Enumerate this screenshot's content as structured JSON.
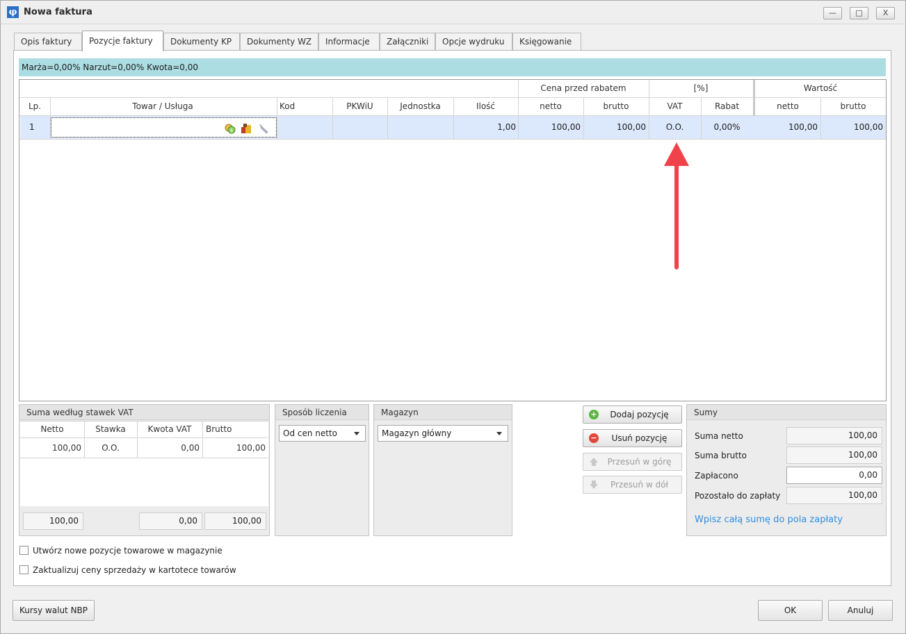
{
  "window": {
    "title": "Nowa faktura",
    "icon": "phi-icon",
    "min": "—",
    "max": "□",
    "close": "X"
  },
  "tabs": [
    {
      "label": "Opis faktury"
    },
    {
      "label": "Pozycje faktury"
    },
    {
      "label": "Dokumenty KP"
    },
    {
      "label": "Dokumenty WZ"
    },
    {
      "label": "Informacje"
    },
    {
      "label": "Załączniki"
    },
    {
      "label": "Opcje wydruku"
    },
    {
      "label": "Księgowanie"
    }
  ],
  "info": "Marża=0,00%  Narzut=0,00%  Kwota=0,00",
  "grid": {
    "bands": {
      "cena": "Cena przed rabatem",
      "pct": "[%]",
      "wartosc": "Wartość"
    },
    "headers": {
      "lp": "Lp.",
      "towar": "Towar / Usługa",
      "kod": "Kod",
      "pkwiu": "PKWiU",
      "jednostka": "Jednostka",
      "ilosc": "Ilość",
      "netto": "netto",
      "brutto": "brutto",
      "vat": "VAT",
      "rabat": "Rabat",
      "w_netto": "netto",
      "w_brutto": "brutto"
    },
    "row": {
      "lp": "1",
      "towar": "",
      "kod": "",
      "pkwiu": "",
      "jednostka": "",
      "ilosc": "1,00",
      "netto": "100,00",
      "brutto": "100,00",
      "vat": "O.O.",
      "rabat": "0,00%",
      "w_netto": "100,00",
      "w_brutto": "100,00"
    }
  },
  "vat_group": {
    "title": "Suma według stawek VAT",
    "headers": {
      "netto": "Netto",
      "stawka": "Stawka",
      "kwota": "Kwota VAT",
      "brutto": "Brutto"
    },
    "row": {
      "netto": "100,00",
      "stawka": "O.O.",
      "kwota": "0,00",
      "brutto": "100,00"
    },
    "totals": {
      "netto": "100,00",
      "kwota": "0,00",
      "brutto": "100,00"
    }
  },
  "sposob": {
    "title": "Sposób liczenia",
    "value": "Od cen netto"
  },
  "magazyn": {
    "title": "Magazyn",
    "value": "Magazyn główny"
  },
  "buttons": {
    "dodaj": "Dodaj pozycję",
    "usun": "Usuń pozycję",
    "gora": "Przesuń w górę",
    "dol": "Przesuń w dół",
    "kursy": "Kursy walut NBP",
    "ok": "OK",
    "anuluj": "Anuluj"
  },
  "sumy": {
    "title": "Sumy",
    "netto_label": "Suma netto",
    "netto": "100,00",
    "brutto_label": "Suma brutto",
    "brutto": "100,00",
    "zaplacono_label": "Zapłacono",
    "zaplacono": "0,00",
    "pozostalo_label": "Pozostało do zapłaty",
    "pozostalo": "100,00",
    "link": "Wpisz całą sumę do pola zapłaty"
  },
  "checkboxes": {
    "nowe": "Utwórz nowe pozycje towarowe w magazynie",
    "ceny": "Zaktualizuj ceny sprzedaży w kartotece towarów"
  },
  "colors": {
    "info_bar": "#acdde2",
    "row_selected": "#dce8fb",
    "arrow": "#f0424a",
    "link": "#2f8de0"
  }
}
